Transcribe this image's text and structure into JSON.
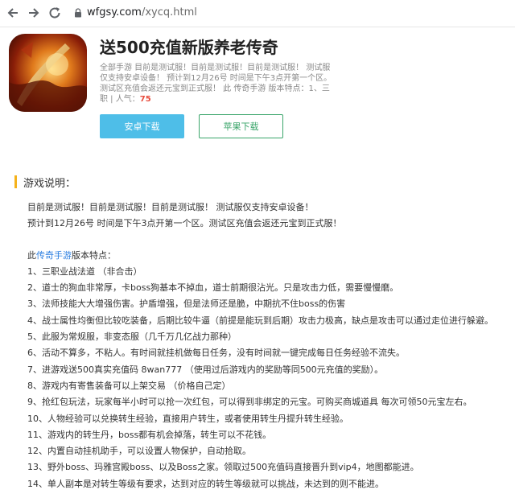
{
  "browser": {
    "url_host": "wfgsy.com",
    "url_path": "/xycq.html",
    "icons": [
      "back-arrow-icon",
      "forward-arrow-icon",
      "reload-icon",
      "lock-icon"
    ]
  },
  "app": {
    "title": "送500充值新版养老传奇",
    "desc_text": "全部手游   目前是测试服！目前是测试服！目前是测试服！ 测试服仅支持安卓设备！ 预计到12月26号 时间是下午3点开第一个区。测试区充值会返还元宝到正式服！ 此 传奇手游 版本特点：1、三职   |    人气：",
    "popularity": "75",
    "android_button": "安卓下载",
    "apple_button": "苹果下载",
    "colors": {
      "android": "#4ebee8",
      "apple": "#3aa56a",
      "popularity": "#e84b3c",
      "section_bar": "#f5b21b",
      "link": "#2a7ee0"
    }
  },
  "section": {
    "title": "游戏说明："
  },
  "content": {
    "intro": [
      "目前是测试服！目前是测试服！目前是测试服！ 测试服仅支持安卓设备！",
      "预计到12月26号 时间是下午3点开第一个区。测试区充值会返还元宝到正式服！"
    ],
    "features_prefix": "此",
    "features_link": "传奇手游",
    "features_suffix": "版本特点：",
    "items": [
      "1、三职业战法道 （非合击）",
      "2、道士的狗血非常厚，卡boss狗基本不掉血，道士前期很沾光。只是攻击力低，需要慢慢磨。",
      "3、法师技能大大增强伤害。护盾增强，但是法师还是脆，中期抗不住boss的伤害",
      "4、战士属性均衡但比较吃装备，后期比较牛逼（前提是能玩到后期）攻击力极高，缺点是攻击可以通过走位进行躲避。",
      "5、此服为常规服，非变态服（几千万几亿战力那种）",
      "6、活动不算多，不粘人。有时间就挂机做每日任务，没有时间就一键完成每日任务经验不流失。",
      "7、进游戏送500真实充值码  8wan777 （使用过后游戏内的奖励等同500元充值的奖励）。",
      "8、游戏内有寄售装备可以上架交易 （价格自己定）",
      "9、抢红包玩法，玩家每半小时可以抢一次红包，可以得到非绑定的元宝。可购买商城道具 每次可领50元宝左右。",
      "10、人物经验可以兑换转生经验，直接用户转生，或者使用转生丹提升转生经验。",
      "11、游戏内的转生丹，boss都有机会掉落，转生可以不花钱。",
      "12、内置自动挂机助手，可以设置人物保护，自动拾取。",
      "13、野外boss、玛雅宫殿boss、以及Boss之家。领取过500充值码直接晋升到vip4，地图都能进。",
      "14、单人副本是对转生等级有要求，达到对应的转生等级就可以挑战，未达到的则不能进。"
    ]
  }
}
